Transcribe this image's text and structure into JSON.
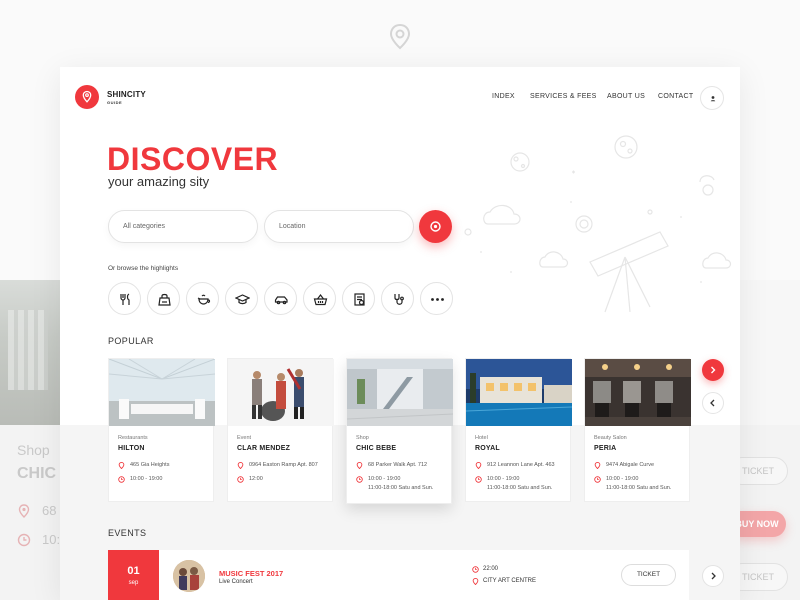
{
  "brand": {
    "name": "SHINCITY",
    "tagline": "GUIDE",
    "color": "#f0383d"
  },
  "nav": {
    "items": [
      "INDEX",
      "SERVICES & FEES",
      "ABOUT US",
      "CONTACT"
    ],
    "user_icon": "user-icon"
  },
  "hero": {
    "title": "DISCOVER",
    "subtitle": "your amazing sity"
  },
  "search": {
    "categories_placeholder": "All categories",
    "location_placeholder": "Location",
    "button_icon": "search-icon"
  },
  "browse": {
    "label": "Or browse the highlights",
    "categories": [
      "restaurant-icon",
      "shopping-bag-icon",
      "tea-icon",
      "education-icon",
      "car-icon",
      "basket-icon",
      "services-icon",
      "health-icon",
      "more-icon"
    ]
  },
  "popular": {
    "heading": "POPULAR",
    "cards": [
      {
        "type": "Restaurants",
        "name": "HILTON",
        "address": "465 Gia Heights",
        "hours": [
          "10:00 - 19:00"
        ]
      },
      {
        "type": "Event",
        "name": "CLAR MENDEZ",
        "address": "0964 Easton Ramp Apt. 807",
        "hours": [
          "12:00"
        ]
      },
      {
        "type": "Shop",
        "name": "CHIC BEBE",
        "address": "68 Parker Walk Apt. 712",
        "hours": [
          "10:00 - 19:00",
          "11:00-18:00 Satu and Sun."
        ]
      },
      {
        "type": "Hotel",
        "name": "ROYAL",
        "address": "912 Leannon Lane Apt. 463",
        "hours": [
          "10:00 - 19:00",
          "11:00-18:00 Satu and Sun."
        ]
      },
      {
        "type": "Beauty Salon",
        "name": "PERIA",
        "address": "9474 Abigale Curve",
        "hours": [
          "10:00 - 19:00",
          "11:00-18:00 Satu and Sun."
        ]
      }
    ]
  },
  "events": {
    "heading": "EVENTS",
    "items": [
      {
        "day": "01",
        "month": "sep",
        "title": "MUSIC FEST 2017",
        "subtitle": "Live Concert",
        "time": "22:00",
        "venue": "CITY ART CENTRE",
        "button": "TICKET"
      }
    ]
  },
  "background": {
    "type": "Shop",
    "name": "CHIC",
    "address_partial": "68",
    "hours_partial": "10:",
    "buttons": [
      "TICKET",
      "BUY NOW",
      "TICKET"
    ]
  }
}
